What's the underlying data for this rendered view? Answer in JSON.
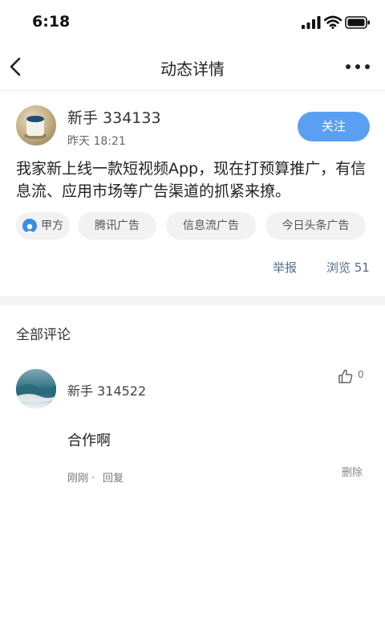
{
  "status_bar": {
    "time": "6:18"
  },
  "nav": {
    "title": "动态详情",
    "back_icon": "chevron-left-icon",
    "more_icon": "more-horizontal-icon"
  },
  "post": {
    "author": "新手 334133",
    "time": "昨天 18:21",
    "follow_label": "关注",
    "text": "我家新上线一款短视频App，现在打预算推广，有信息流、应用市场等广告渠道的抓紧来撩。",
    "author_tag": "甲方",
    "tags": [
      "腾讯广告",
      "信息流广告",
      "今日头条广告"
    ],
    "report_label": "举报",
    "views_label": "浏览 51"
  },
  "comments_section": {
    "title": "全部评论",
    "comments": [
      {
        "author": "新手 314522",
        "text": "合作啊",
        "time": "刚刚",
        "separator": "·",
        "reply_label": "回复",
        "likes": "0",
        "delete_label": "删除"
      }
    ]
  },
  "colors": {
    "accent": "#5aa0f2",
    "tag_bg": "#f2f2f2",
    "link": "#55708c"
  }
}
